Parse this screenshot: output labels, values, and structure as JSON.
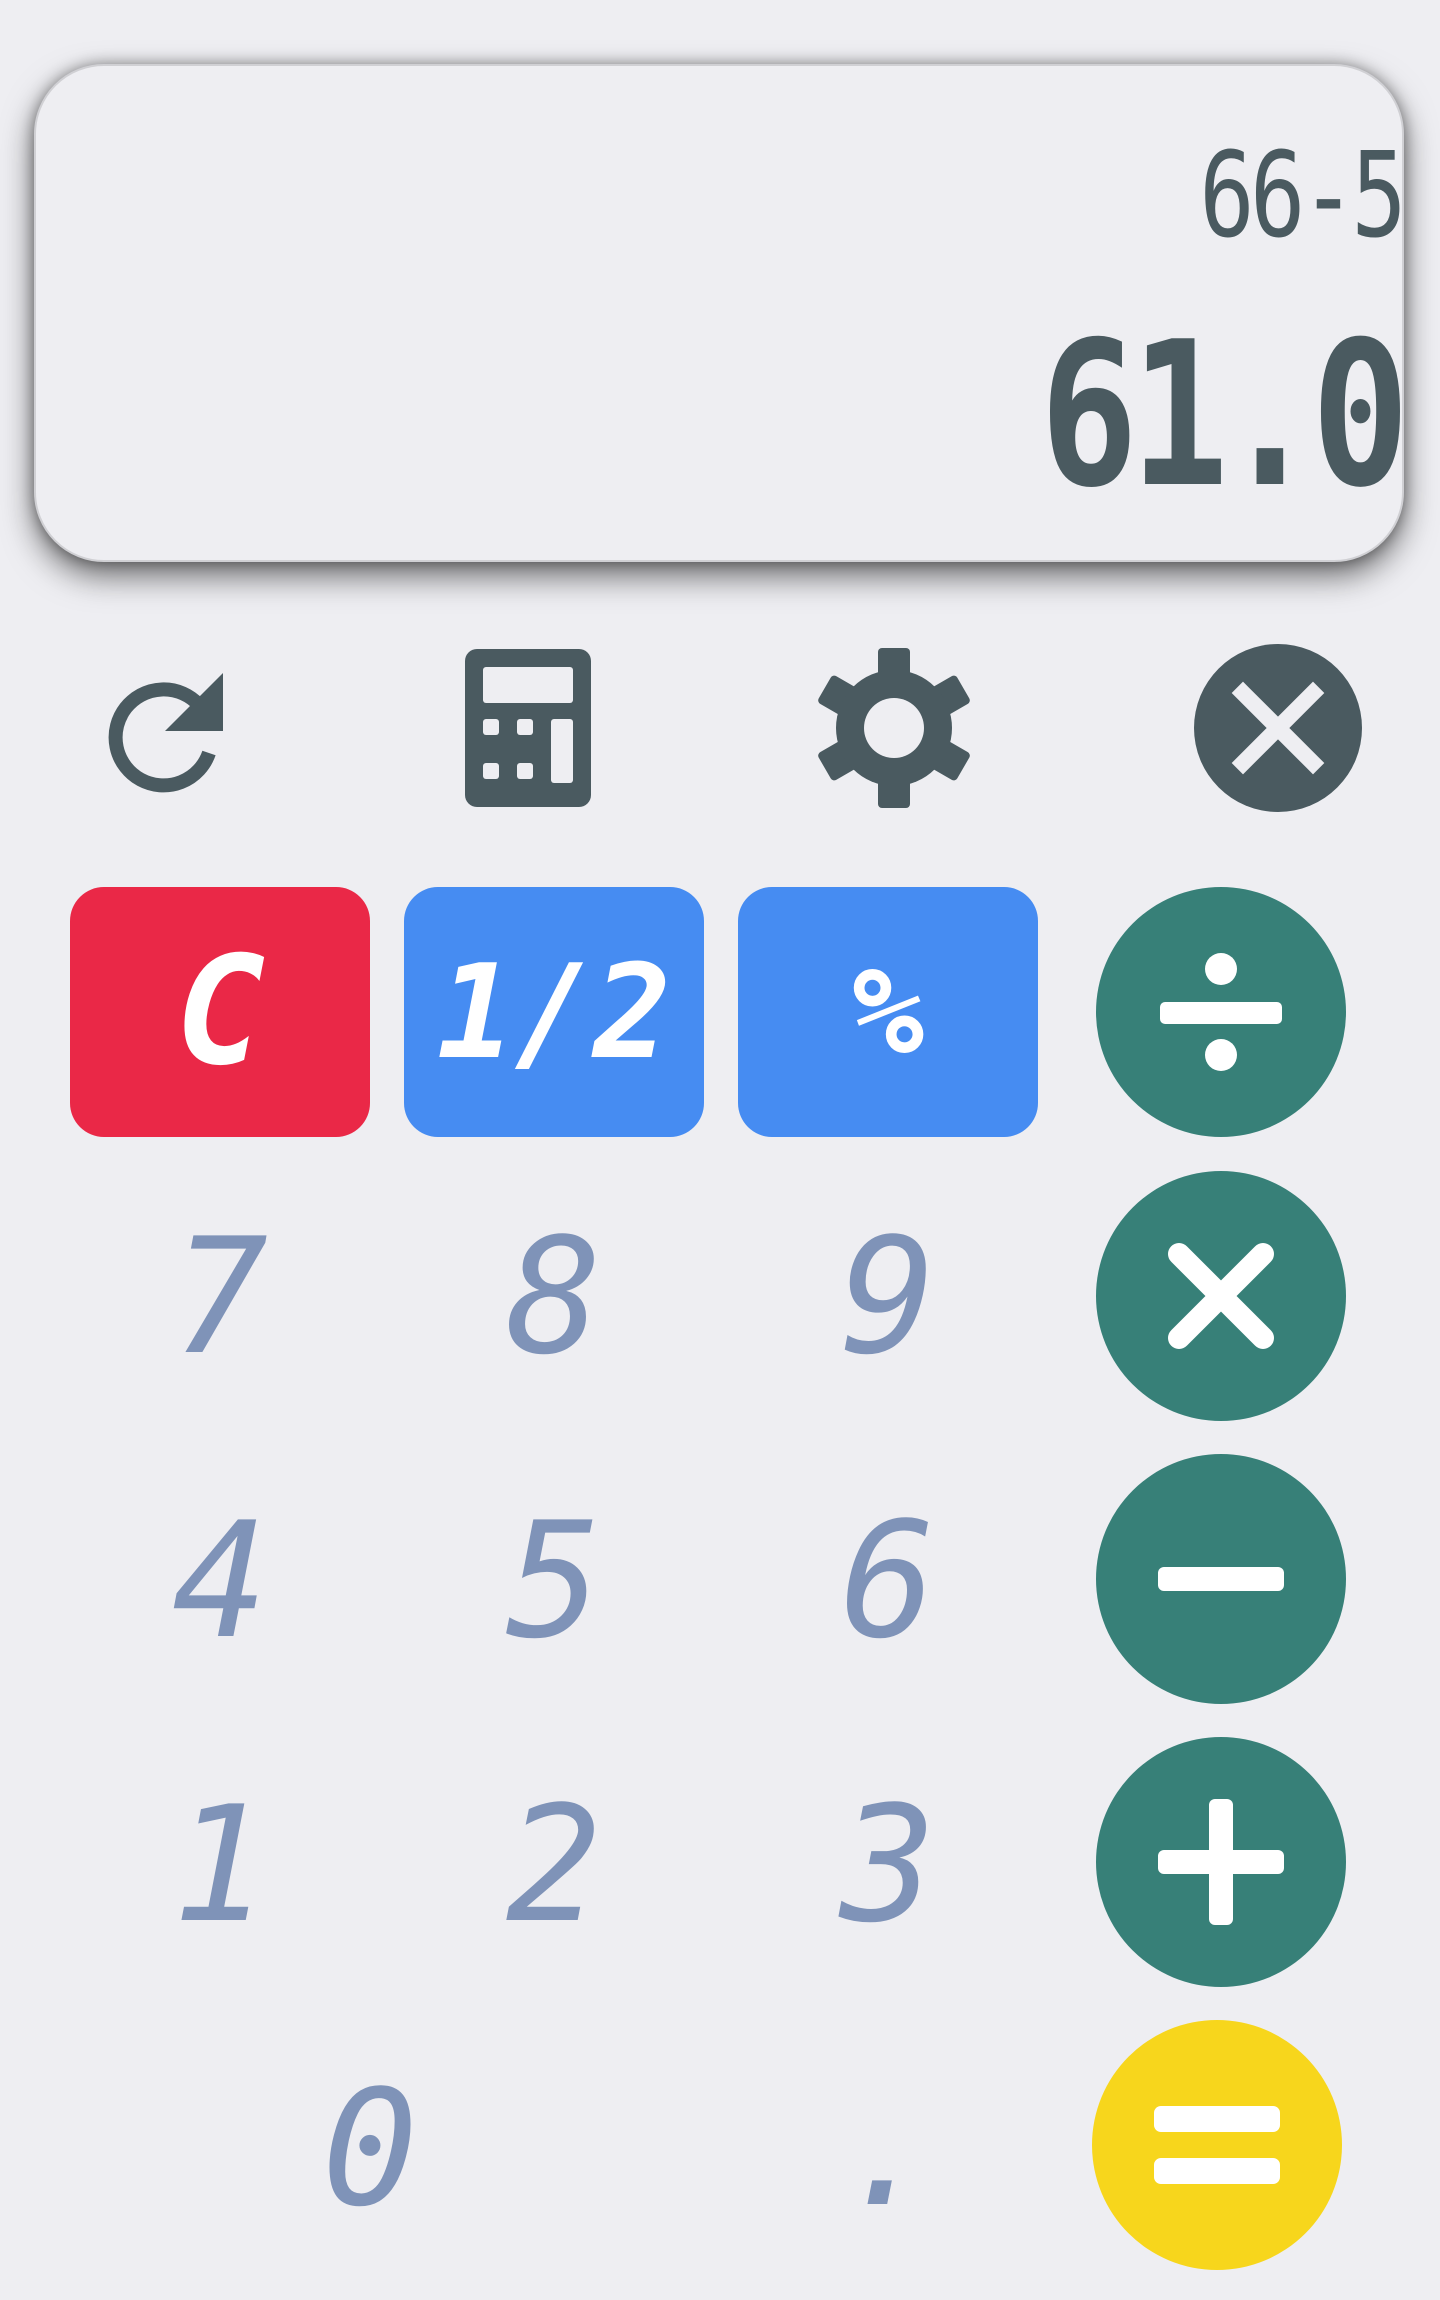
{
  "display": {
    "expression": "66-5",
    "result": "61.0"
  },
  "toolbar": {
    "history_icon": "history-refresh-icon",
    "calculator_icon": "calculator-icon",
    "settings_icon": "gear-icon",
    "close_icon": "close-circle-icon"
  },
  "keys": {
    "clear": "C",
    "half": "1/2",
    "percent": "%",
    "seven": "7",
    "eight": "8",
    "nine": "9",
    "four": "4",
    "five": "5",
    "six": "6",
    "one": "1",
    "two": "2",
    "three": "3",
    "zero": "0",
    "decimal": "."
  },
  "operators": {
    "divide": "divide-icon",
    "multiply": "multiply-icon",
    "subtract": "minus-icon",
    "add": "plus-icon",
    "equals": "equals-icon"
  },
  "colors": {
    "background": "#eeeef2",
    "display_text": "#4a5a60",
    "clear_key": "#ea2847",
    "function_key": "#468cf2",
    "digit_text": "#7f93b8",
    "operator": "#378078",
    "equals": "#f7d61c"
  }
}
